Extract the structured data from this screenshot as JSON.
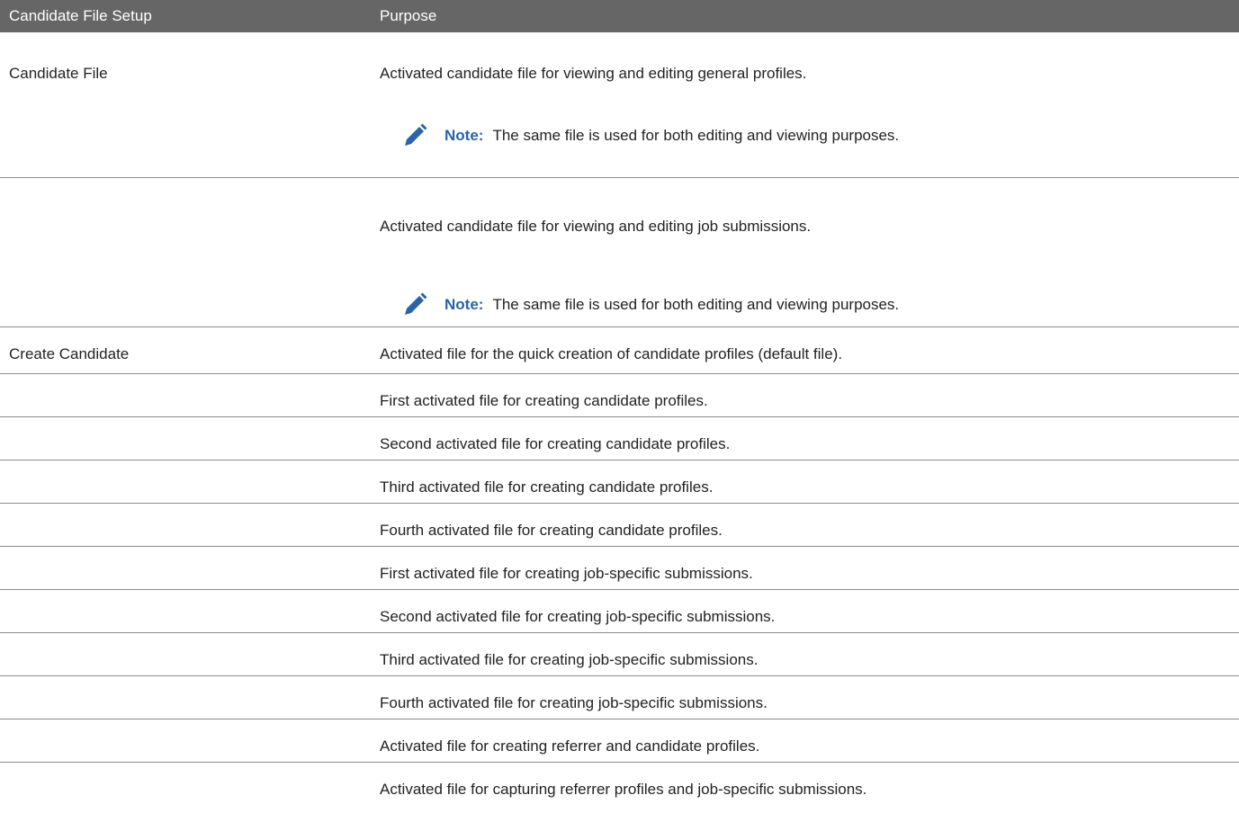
{
  "header": {
    "col1": "Candidate File Setup",
    "col2": "Purpose"
  },
  "rows": [
    {
      "setup": "Candidate File",
      "purpose": "Activated candidate file for viewing and editing general profiles.",
      "note_label": "Note:",
      "note_text": "The same file is used for both editing and viewing purposes."
    },
    {
      "setup": "",
      "purpose": "Activated candidate file for viewing and editing job submissions.",
      "note_label": "Note:",
      "note_text": "The same file is used for both editing and viewing purposes."
    },
    {
      "setup": "Create Candidate",
      "purpose": "Activated file for the quick creation of candidate profiles (default file)."
    },
    {
      "setup": "",
      "purpose": "First activated file for creating candidate profiles."
    },
    {
      "setup": "",
      "purpose": "Second activated file for creating candidate profiles."
    },
    {
      "setup": "",
      "purpose": "Third activated file for creating candidate profiles."
    },
    {
      "setup": "",
      "purpose": "Fourth activated file for creating candidate profiles."
    },
    {
      "setup": "",
      "purpose": "First activated file for creating job-specific submissions."
    },
    {
      "setup": "",
      "purpose": "Second activated file for creating job-specific submissions."
    },
    {
      "setup": "",
      "purpose": "Third activated file for creating job-specific submissions."
    },
    {
      "setup": "",
      "purpose": "Fourth activated file for creating job-specific submissions."
    },
    {
      "setup": "",
      "purpose": "Activated file for creating referrer and candidate profiles."
    },
    {
      "setup": "",
      "purpose": "Activated file for capturing referrer profiles and job-specific submissions."
    }
  ],
  "icons": {
    "note": "pencil-icon"
  },
  "colors": {
    "header_bg": "#666666",
    "note_label": "#2a63a6",
    "pencil": "#2a63a6"
  }
}
